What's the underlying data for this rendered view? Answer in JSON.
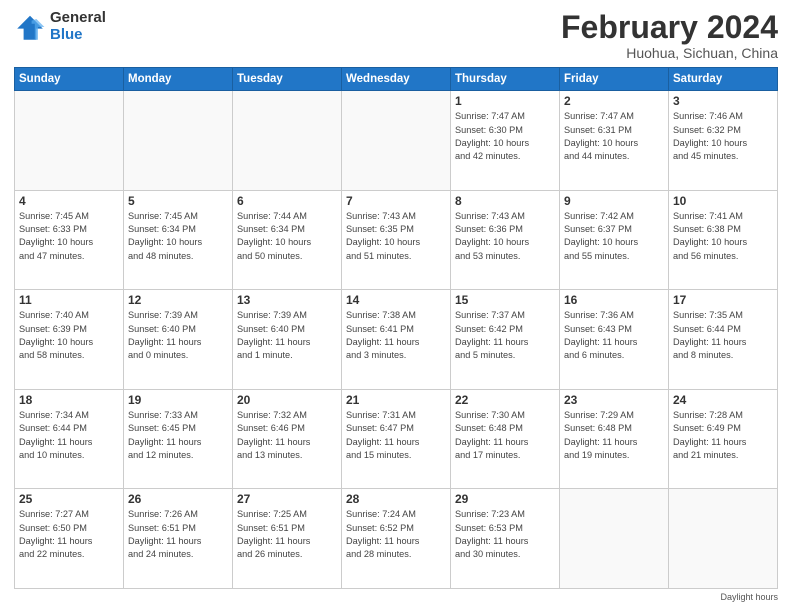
{
  "header": {
    "logo": {
      "general": "General",
      "blue": "Blue"
    },
    "title": "February 2024",
    "location": "Huohua, Sichuan, China"
  },
  "weekdays": [
    "Sunday",
    "Monday",
    "Tuesday",
    "Wednesday",
    "Thursday",
    "Friday",
    "Saturday"
  ],
  "weeks": [
    [
      {
        "day": "",
        "info": ""
      },
      {
        "day": "",
        "info": ""
      },
      {
        "day": "",
        "info": ""
      },
      {
        "day": "",
        "info": ""
      },
      {
        "day": "1",
        "info": "Sunrise: 7:47 AM\nSunset: 6:30 PM\nDaylight: 10 hours\nand 42 minutes."
      },
      {
        "day": "2",
        "info": "Sunrise: 7:47 AM\nSunset: 6:31 PM\nDaylight: 10 hours\nand 44 minutes."
      },
      {
        "day": "3",
        "info": "Sunrise: 7:46 AM\nSunset: 6:32 PM\nDaylight: 10 hours\nand 45 minutes."
      }
    ],
    [
      {
        "day": "4",
        "info": "Sunrise: 7:45 AM\nSunset: 6:33 PM\nDaylight: 10 hours\nand 47 minutes."
      },
      {
        "day": "5",
        "info": "Sunrise: 7:45 AM\nSunset: 6:34 PM\nDaylight: 10 hours\nand 48 minutes."
      },
      {
        "day": "6",
        "info": "Sunrise: 7:44 AM\nSunset: 6:34 PM\nDaylight: 10 hours\nand 50 minutes."
      },
      {
        "day": "7",
        "info": "Sunrise: 7:43 AM\nSunset: 6:35 PM\nDaylight: 10 hours\nand 51 minutes."
      },
      {
        "day": "8",
        "info": "Sunrise: 7:43 AM\nSunset: 6:36 PM\nDaylight: 10 hours\nand 53 minutes."
      },
      {
        "day": "9",
        "info": "Sunrise: 7:42 AM\nSunset: 6:37 PM\nDaylight: 10 hours\nand 55 minutes."
      },
      {
        "day": "10",
        "info": "Sunrise: 7:41 AM\nSunset: 6:38 PM\nDaylight: 10 hours\nand 56 minutes."
      }
    ],
    [
      {
        "day": "11",
        "info": "Sunrise: 7:40 AM\nSunset: 6:39 PM\nDaylight: 10 hours\nand 58 minutes."
      },
      {
        "day": "12",
        "info": "Sunrise: 7:39 AM\nSunset: 6:40 PM\nDaylight: 11 hours\nand 0 minutes."
      },
      {
        "day": "13",
        "info": "Sunrise: 7:39 AM\nSunset: 6:40 PM\nDaylight: 11 hours\nand 1 minute."
      },
      {
        "day": "14",
        "info": "Sunrise: 7:38 AM\nSunset: 6:41 PM\nDaylight: 11 hours\nand 3 minutes."
      },
      {
        "day": "15",
        "info": "Sunrise: 7:37 AM\nSunset: 6:42 PM\nDaylight: 11 hours\nand 5 minutes."
      },
      {
        "day": "16",
        "info": "Sunrise: 7:36 AM\nSunset: 6:43 PM\nDaylight: 11 hours\nand 6 minutes."
      },
      {
        "day": "17",
        "info": "Sunrise: 7:35 AM\nSunset: 6:44 PM\nDaylight: 11 hours\nand 8 minutes."
      }
    ],
    [
      {
        "day": "18",
        "info": "Sunrise: 7:34 AM\nSunset: 6:44 PM\nDaylight: 11 hours\nand 10 minutes."
      },
      {
        "day": "19",
        "info": "Sunrise: 7:33 AM\nSunset: 6:45 PM\nDaylight: 11 hours\nand 12 minutes."
      },
      {
        "day": "20",
        "info": "Sunrise: 7:32 AM\nSunset: 6:46 PM\nDaylight: 11 hours\nand 13 minutes."
      },
      {
        "day": "21",
        "info": "Sunrise: 7:31 AM\nSunset: 6:47 PM\nDaylight: 11 hours\nand 15 minutes."
      },
      {
        "day": "22",
        "info": "Sunrise: 7:30 AM\nSunset: 6:48 PM\nDaylight: 11 hours\nand 17 minutes."
      },
      {
        "day": "23",
        "info": "Sunrise: 7:29 AM\nSunset: 6:48 PM\nDaylight: 11 hours\nand 19 minutes."
      },
      {
        "day": "24",
        "info": "Sunrise: 7:28 AM\nSunset: 6:49 PM\nDaylight: 11 hours\nand 21 minutes."
      }
    ],
    [
      {
        "day": "25",
        "info": "Sunrise: 7:27 AM\nSunset: 6:50 PM\nDaylight: 11 hours\nand 22 minutes."
      },
      {
        "day": "26",
        "info": "Sunrise: 7:26 AM\nSunset: 6:51 PM\nDaylight: 11 hours\nand 24 minutes."
      },
      {
        "day": "27",
        "info": "Sunrise: 7:25 AM\nSunset: 6:51 PM\nDaylight: 11 hours\nand 26 minutes."
      },
      {
        "day": "28",
        "info": "Sunrise: 7:24 AM\nSunset: 6:52 PM\nDaylight: 11 hours\nand 28 minutes."
      },
      {
        "day": "29",
        "info": "Sunrise: 7:23 AM\nSunset: 6:53 PM\nDaylight: 11 hours\nand 30 minutes."
      },
      {
        "day": "",
        "info": ""
      },
      {
        "day": "",
        "info": ""
      }
    ]
  ],
  "footer": {
    "daylight_label": "Daylight hours"
  }
}
